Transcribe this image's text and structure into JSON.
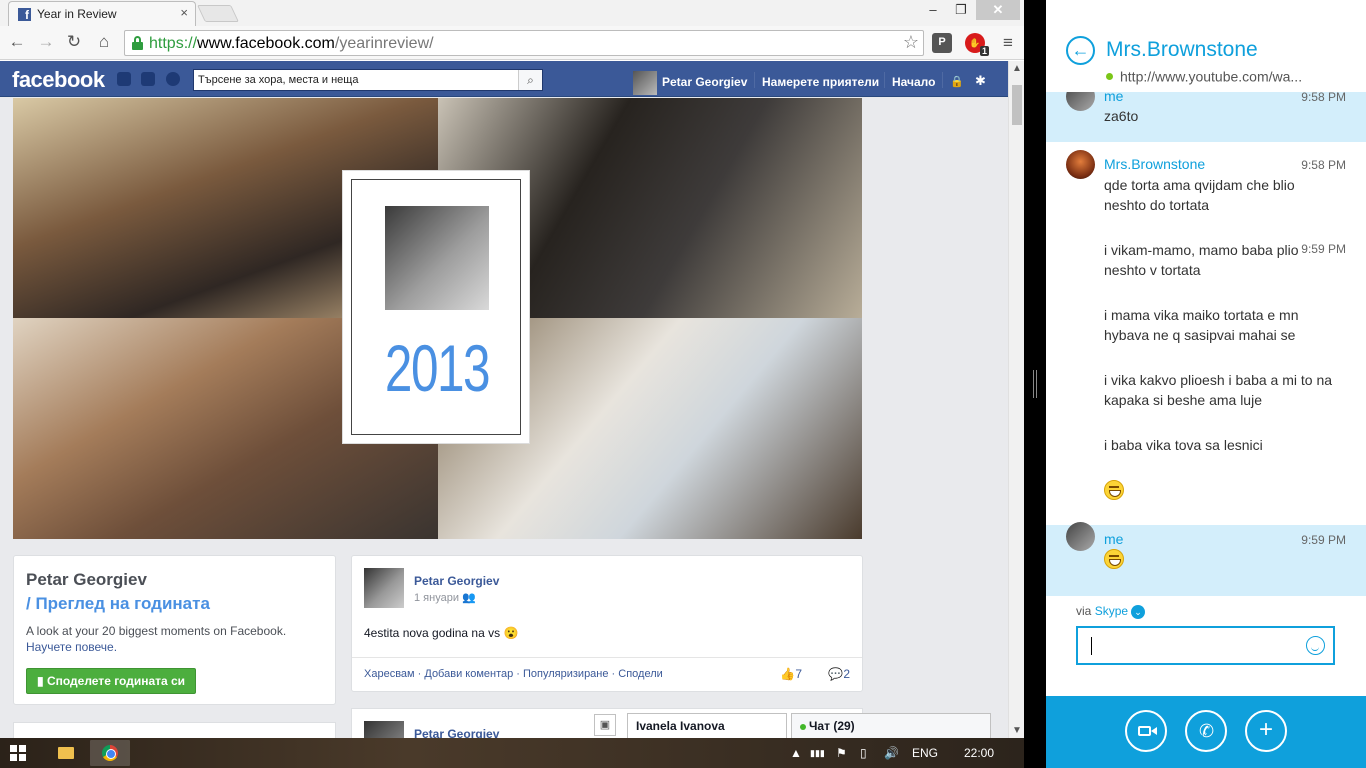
{
  "browser": {
    "tab_title": "Year in Review",
    "tab_close": "×",
    "window_controls": {
      "minimize": "‒",
      "maximize": "❐",
      "close": "✕"
    },
    "nav": {
      "back": "←",
      "forward": "→",
      "reload": "↻",
      "home": "⌂"
    },
    "url_scheme": "https://",
    "url_host": "www.facebook.com",
    "url_path": "/yearinreview/",
    "star": "☆",
    "pocket_label": "P",
    "adblock_count": "1",
    "menu": "≡"
  },
  "facebook": {
    "logo": "facebook",
    "search_placeholder": "Търсене за хора, места и неща",
    "search_icon": "⌕",
    "user_name": "Petar Georgiev",
    "find_friends": "Намерете приятели",
    "home": "Начало",
    "lock_icon": "🔒",
    "gear_icon": "✱",
    "cover": {
      "year": "2013"
    },
    "left_box": {
      "name": "Petar Georgiev",
      "subtitle": "/ Преглед на годината",
      "description": "A look at your 20 biggest moments on Facebook.",
      "learn_more": "Научете повече.",
      "share_button": "Споделете годината си",
      "share_icon": "▮"
    },
    "post": {
      "author": "Petar Georgiev",
      "date": "1 януари",
      "audience_icon": "👥",
      "text": "4estita nova godina na vs",
      "emoticon": "😮",
      "actions": "Харесвам · Добави коментар · Популяризиране · Сподели",
      "like_count": "7",
      "comment_count": "2",
      "like_icon": "👍",
      "comment_icon": "💬"
    },
    "post2": {
      "author": "Petar Georgiev"
    },
    "chat_window_name": "Ivanela Ivanova",
    "chat_label": "Чат (29)"
  },
  "taskbar": {
    "lang": "ENG",
    "clock": "22:00",
    "tray_icons": [
      "▲",
      "▮▮▮",
      "⚑",
      "▯",
      "🔊"
    ]
  },
  "skype": {
    "back_icon": "←",
    "contact_name": "Mrs.Brownstone",
    "mood": "http://www.youtube.com/wa...",
    "messages": [
      {
        "sender": "me",
        "time": "9:58 PM",
        "text": "za6to"
      },
      {
        "sender": "Mrs.Brownstone",
        "time": "9:58 PM",
        "text": "qde torta ama qvijdam che blio neshto do tortata"
      },
      {
        "time": "9:59 PM",
        "text": "i vikam-mamo, mamo baba plio neshto v tortata"
      },
      {
        "text": "i mama vika maiko tortata e mn hybava ne q sasipvai mahai se"
      },
      {
        "text": "i vika kakvo plioesh i baba a mi to na kapaka si beshe ama luje"
      },
      {
        "text": "i baba vika tova sa lesnici"
      },
      {
        "sender": "me",
        "time": "9:59 PM"
      }
    ],
    "via_prefix": "via",
    "via_service": "Skype",
    "chevron": "⌄",
    "input_value": "",
    "add_icon": "+",
    "call_icon": "✆"
  }
}
